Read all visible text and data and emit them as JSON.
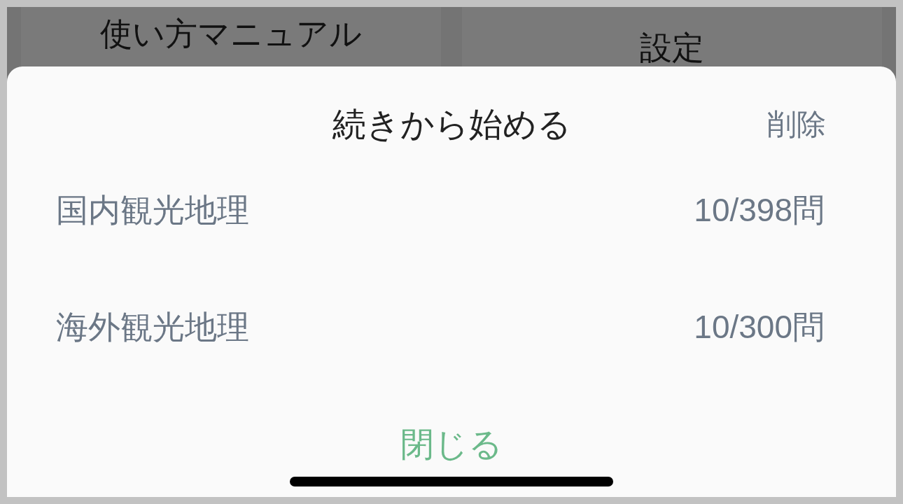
{
  "background": {
    "buttons": [
      {
        "label": "使い方マニュアル"
      },
      {
        "label": "設定"
      }
    ]
  },
  "sheet": {
    "title": "続きから始める",
    "action": "削除",
    "items": [
      {
        "name": "国内観光地理",
        "progress": "10/398問"
      },
      {
        "name": "海外観光地理",
        "progress": "10/300問"
      }
    ],
    "close_button": "閉じる"
  }
}
